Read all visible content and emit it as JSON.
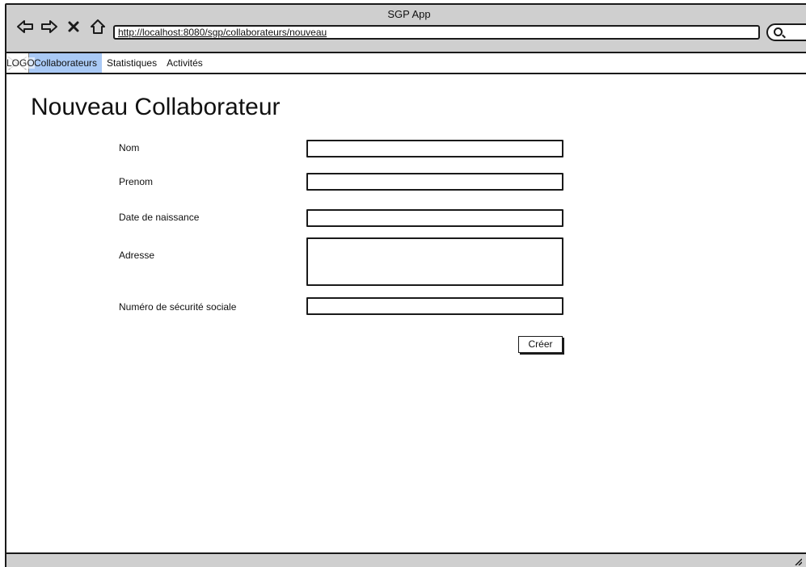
{
  "window": {
    "title": "SGP App"
  },
  "browser": {
    "url": "http://localhost:8080/sgp/collaborateurs/nouveau",
    "icons": [
      "back-arrow-icon",
      "forward-arrow-icon",
      "stop-icon",
      "home-icon",
      "search-icon"
    ]
  },
  "menubar": {
    "logo": "LOGO",
    "items": [
      {
        "label": "Collaborateurs",
        "active": true
      },
      {
        "label": "Statistiques",
        "active": false
      },
      {
        "label": "Activités",
        "active": false
      }
    ]
  },
  "page": {
    "title": "Nouveau Collaborateur",
    "fields": [
      {
        "label": "Nom",
        "value": ""
      },
      {
        "label": "Prenom",
        "value": ""
      },
      {
        "label": "Date de naissance",
        "value": ""
      },
      {
        "label": "Adresse",
        "value": ""
      },
      {
        "label": "Numéro de sécurité sociale",
        "value": ""
      }
    ],
    "submit_label": "Créer"
  },
  "colors": {
    "chrome": "#cfcfcf",
    "active_menu": "#a9c9f5",
    "border": "#1a1a1a"
  }
}
